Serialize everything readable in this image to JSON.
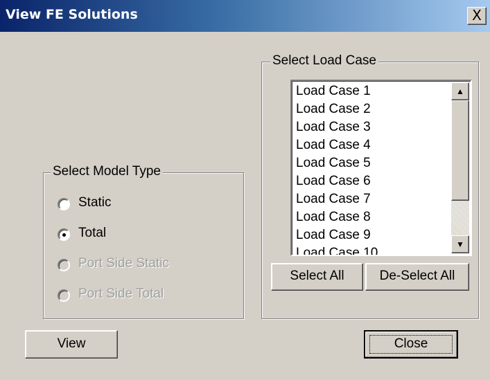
{
  "window": {
    "title": "View FE Solutions",
    "close_glyph": "X"
  },
  "model_type": {
    "legend": "Select Model Type",
    "options": [
      {
        "label": "Static",
        "selected": false,
        "enabled": true
      },
      {
        "label": "Total",
        "selected": true,
        "enabled": true
      },
      {
        "label": "Port Side Static",
        "selected": false,
        "enabled": false
      },
      {
        "label": "Port Side Total",
        "selected": false,
        "enabled": false
      }
    ]
  },
  "load_case": {
    "legend": "Select Load Case",
    "items": [
      "Load Case 1",
      "Load Case 2",
      "Load Case 3",
      "Load Case 4",
      "Load Case 5",
      "Load Case 6",
      "Load Case 7",
      "Load Case 8",
      "Load Case 9",
      "Load Case 10"
    ],
    "scroll_up_glyph": "▲",
    "scroll_down_glyph": "▼",
    "select_all_label": "Select All",
    "deselect_all_label": "De-Select All"
  },
  "buttons": {
    "view_label": "View",
    "close_label": "Close"
  },
  "colors": {
    "face": "#d4d0c8",
    "title_start": "#0a246a",
    "title_end": "#a6caf0",
    "disabled_text": "#a0a0a0"
  },
  "icons": {
    "close": "close-icon",
    "scroll_up": "scroll-up-arrow-icon",
    "scroll_down": "scroll-down-arrow-icon"
  }
}
